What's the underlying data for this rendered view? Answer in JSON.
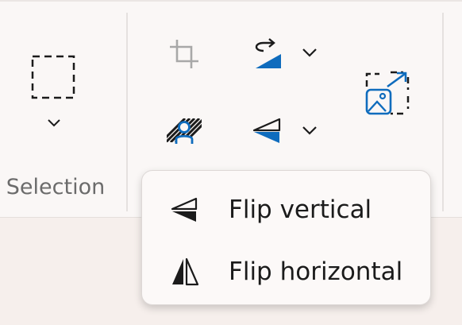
{
  "ribbon": {
    "selection_group": {
      "label": "Selection",
      "select_button": {
        "icon": "dashed-rectangle-icon"
      },
      "dropdown": {
        "icon": "chevron-down-icon"
      }
    },
    "image_group": {
      "crop": {
        "icon": "crop-icon",
        "enabled": false
      },
      "rotate": {
        "icon": "rotate-icon"
      },
      "remove_background": {
        "icon": "remove-background-icon"
      },
      "flip": {
        "icon": "flip-vertical-icon"
      },
      "resize": {
        "icon": "resize-image-icon"
      }
    }
  },
  "flip_menu": {
    "items": [
      {
        "label": "Flip vertical",
        "icon": "flip-vertical-icon"
      },
      {
        "label": "Flip horizontal",
        "icon": "flip-horizontal-icon"
      }
    ]
  },
  "colors": {
    "accent": "#0f6cbd",
    "icon": "#1b1b1b",
    "disabled": "#a8a8a8"
  }
}
